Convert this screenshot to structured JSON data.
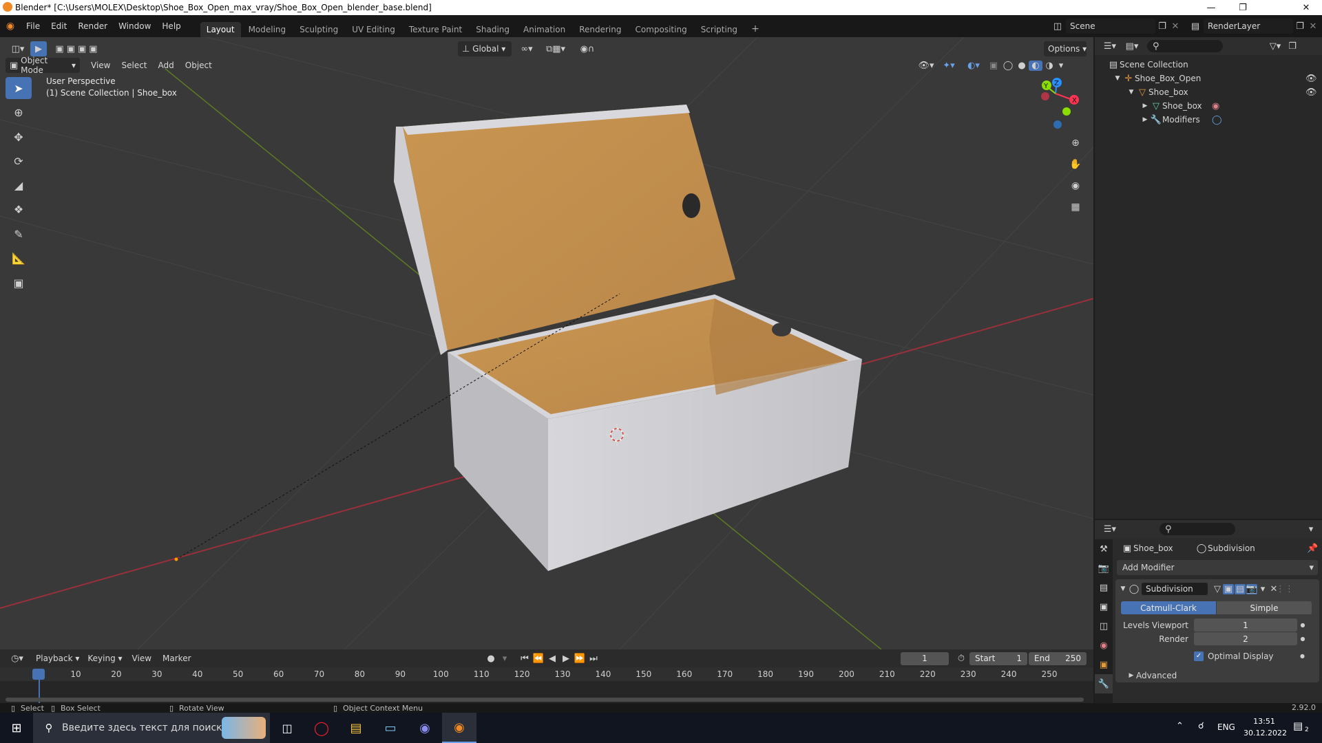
{
  "window": {
    "title": "Blender* [C:\\Users\\MOLEX\\Desktop\\Shoe_Box_Open_max_vray/Shoe_Box_Open_blender_base.blend]"
  },
  "menu": [
    "File",
    "Edit",
    "Render",
    "Window",
    "Help"
  ],
  "workspaces": [
    "Layout",
    "Modeling",
    "Sculpting",
    "UV Editing",
    "Texture Paint",
    "Shading",
    "Animation",
    "Rendering",
    "Compositing",
    "Scripting"
  ],
  "active_workspace": "Layout",
  "scene": {
    "name": "Scene",
    "render_layer": "RenderLayer"
  },
  "viewport": {
    "mode": "Object Mode",
    "menus": [
      "View",
      "Select",
      "Add",
      "Object"
    ],
    "orientation": "Global",
    "options_label": "Options",
    "overlay_line1": "User Perspective",
    "overlay_line2": "(1) Scene Collection | Shoe_box",
    "gizmo_axes": {
      "x": "X",
      "y": "Y",
      "z": "Z"
    }
  },
  "outliner": {
    "root": "Scene Collection",
    "items": [
      {
        "label": "Shoe_Box_Open",
        "depth": 1
      },
      {
        "label": "Shoe_box",
        "depth": 2
      },
      {
        "label": "Shoe_box",
        "depth": 3
      },
      {
        "label": "Modifiers",
        "depth": 3
      }
    ]
  },
  "properties": {
    "object_name": "Shoe_box",
    "modifier_crumb": "Subdivision",
    "add_modifier": "Add Modifier",
    "modifier": {
      "name": "Subdivision",
      "types": [
        "Catmull-Clark",
        "Simple"
      ],
      "active_type": "Catmull-Clark",
      "levels_viewport_label": "Levels Viewport",
      "levels_viewport": "1",
      "render_label": "Render",
      "render": "2",
      "optimal_display_label": "Optimal Display",
      "optimal_display": true,
      "advanced_label": "Advanced"
    }
  },
  "timeline": {
    "menus": [
      "Playback",
      "Keying",
      "View",
      "Marker"
    ],
    "current_frame": "1",
    "start_label": "Start",
    "start": "1",
    "end_label": "End",
    "end": "250",
    "ruler": [
      "1",
      "10",
      "20",
      "30",
      "40",
      "50",
      "60",
      "70",
      "80",
      "90",
      "100",
      "110",
      "120",
      "130",
      "140",
      "150",
      "160",
      "170",
      "180",
      "190",
      "200",
      "210",
      "220",
      "230",
      "240",
      "250"
    ]
  },
  "statusbar": {
    "select": "Select",
    "box_select": "Box Select",
    "rotate_view": "Rotate View",
    "context_menu": "Object Context Menu",
    "version": "2.92.0"
  },
  "taskbar": {
    "search_placeholder": "Введите здесь текст для поиска",
    "lang": "ENG",
    "time": "13:51",
    "date": "30.12.2022",
    "notifications": "2"
  },
  "colors": {
    "accent": "#4772b3",
    "x_axis": "#ff3352",
    "y_axis": "#8bdc00",
    "z_axis": "#2890ff",
    "box_outside": "#c9c9cd",
    "box_inside": "#c8944f"
  }
}
